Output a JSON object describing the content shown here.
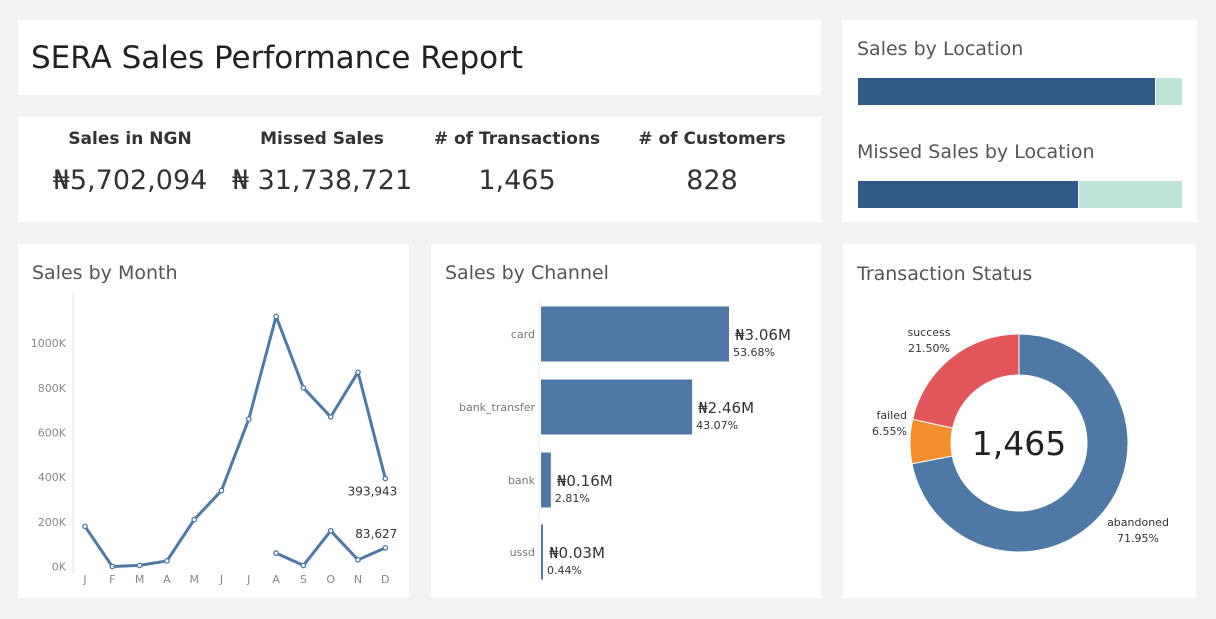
{
  "header": {
    "title": "SERA Sales Performance Report"
  },
  "kpis": [
    {
      "label": "Sales in NGN",
      "value": "₦5,702,094"
    },
    {
      "label": "Missed Sales",
      "value": "₦ 31,738,721"
    },
    {
      "label": "# of Transactions",
      "value": "1,465"
    },
    {
      "label": "# of Customers",
      "value": "828"
    }
  ],
  "location": {
    "sales_title": "Sales by Location",
    "missed_title": "Missed Sales by Location",
    "sales_share": [
      0.92,
      0.08
    ],
    "missed_share": [
      0.68,
      0.32
    ],
    "colors": [
      "#2e5a87",
      "#bfe3d9"
    ]
  },
  "month_panel": {
    "title": "Sales by Month"
  },
  "channel_panel": {
    "title": "Sales by Channel"
  },
  "status_panel": {
    "title": "Transaction Status",
    "center_value": "1,465"
  },
  "chart_data": [
    {
      "type": "line",
      "title": "Sales by Month",
      "categories": [
        "J",
        "F",
        "M",
        "A",
        "M",
        "J",
        "J",
        "A",
        "S",
        "O",
        "N",
        "D"
      ],
      "series": [
        {
          "values": [
            180000,
            0,
            5000,
            25000,
            210000,
            340000,
            660000,
            1120000,
            800000,
            670000,
            870000,
            393943
          ]
        },
        {
          "values": [
            null,
            null,
            null,
            null,
            null,
            null,
            null,
            60000,
            5000,
            160000,
            30000,
            83627
          ]
        }
      ],
      "end_labels": [
        "393,943",
        "83,627"
      ],
      "yticks": [
        0,
        200000,
        400000,
        600000,
        800000,
        1000000
      ],
      "ytick_labels": [
        "0K",
        "200K",
        "400K",
        "600K",
        "800K",
        "1000K"
      ],
      "ylim": [
        -20000,
        1220000
      ],
      "color": "#4e79a7"
    },
    {
      "type": "bar",
      "orientation": "horizontal",
      "title": "Sales by Channel",
      "categories": [
        "card",
        "bank_transfer",
        "bank",
        "ussd"
      ],
      "values": [
        3.06,
        2.46,
        0.16,
        0.03
      ],
      "value_labels": [
        "₦3.06M",
        "₦2.46M",
        "₦0.16M",
        "₦0.03M"
      ],
      "percent_labels": [
        "53.68%",
        "43.07%",
        "2.81%",
        "0.44%"
      ],
      "color": "#4e79a7"
    },
    {
      "type": "pie",
      "style": "donut",
      "title": "Transaction Status",
      "categories": [
        "abandoned",
        "failed",
        "success"
      ],
      "values": [
        71.95,
        6.55,
        21.5
      ],
      "percent_labels": [
        "71.95%",
        "6.55%",
        "21.50%"
      ],
      "colors": [
        "#4e79a7",
        "#f28e2b",
        "#e15759"
      ]
    }
  ]
}
